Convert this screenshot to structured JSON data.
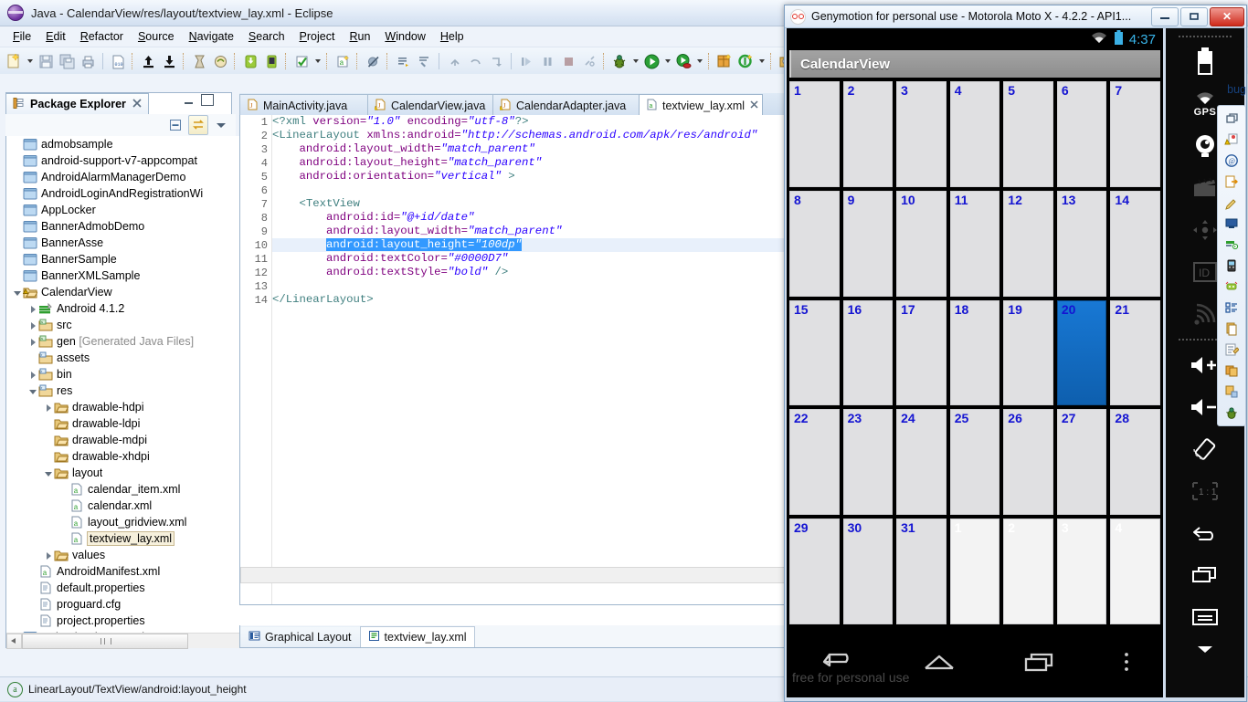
{
  "eclipse": {
    "title": "Java - CalendarView/res/layout/textview_lay.xml - Eclipse",
    "menu": [
      "File",
      "Edit",
      "Refactor",
      "Source",
      "Navigate",
      "Search",
      "Project",
      "Run",
      "Window",
      "Help"
    ],
    "perspective_label": "bug",
    "status_text": "LinearLayout/TextView/android:layout_height",
    "toolbar_icons": [
      "new-wizard-icon",
      "new-wizard-dropdown",
      "save-icon",
      "save-all-icon",
      "print-icon",
      "toggle-binary-icon",
      "export-icon",
      "import-icon",
      "android-sdk-manager-icon",
      "android-virtual-device-icon",
      "android-download-icon",
      "android-device-icon",
      "checkmark-icon",
      "checkmark-dropdown",
      "new-android-project-icon",
      "skip-breakpoints-icon",
      "step-return-icon",
      "lint-icon",
      "next-annotation-icon",
      "previous-annotation-icon",
      "last-edit-location-icon",
      "step-into-icon",
      "pause-icon",
      "terminate-icon",
      "disconnect-icon",
      "debug-icon",
      "debug-dropdown",
      "run-icon",
      "run-dropdown",
      "coverage-icon",
      "coverage-dropdown",
      "new-window-icon",
      "new-java-class-icon",
      "new-java-class-dropdown",
      "open-type-icon"
    ],
    "package_explorer": {
      "tab_label": "Package Explorer",
      "tab_icon": "package-explorer-icon",
      "close_icon": "close-icon",
      "minimize_icon": "minimize-icon",
      "maximize_icon": "maximize-icon",
      "collapse_all_icon": "collapse-all-icon",
      "link_with_editor_icon": "link-with-editor-icon",
      "view_menu_icon": "view-menu-icon",
      "tree": [
        {
          "label": "admobsample",
          "indent": 0,
          "icon": "project-closed",
          "arrow": "none"
        },
        {
          "label": "android-support-v7-appcompat",
          "indent": 0,
          "icon": "project-closed",
          "arrow": "none"
        },
        {
          "label": "AndroidAlarmManagerDemo",
          "indent": 0,
          "icon": "project-closed",
          "arrow": "none"
        },
        {
          "label": "AndroidLoginAndRegistrationWi",
          "indent": 0,
          "icon": "project-closed",
          "arrow": "none"
        },
        {
          "label": "AppLocker",
          "indent": 0,
          "icon": "project-closed",
          "arrow": "none"
        },
        {
          "label": "BannerAdmobDemo",
          "indent": 0,
          "icon": "project-closed",
          "arrow": "none"
        },
        {
          "label": "BannerAsse",
          "indent": 0,
          "icon": "project-closed",
          "arrow": "none"
        },
        {
          "label": "BannerSample",
          "indent": 0,
          "icon": "project-closed",
          "arrow": "none"
        },
        {
          "label": "BannerXMLSample",
          "indent": 0,
          "icon": "project-closed",
          "arrow": "none"
        },
        {
          "label": "CalendarView",
          "indent": 0,
          "icon": "project-open-warning",
          "arrow": "open"
        },
        {
          "label": "Android 4.1.2",
          "indent": 1,
          "icon": "library",
          "arrow": "closed"
        },
        {
          "label": "src",
          "indent": 1,
          "icon": "source-folder",
          "arrow": "closed"
        },
        {
          "label": "gen",
          "suffix": " [Generated Java Files]",
          "indent": 1,
          "icon": "source-folder",
          "arrow": "closed"
        },
        {
          "label": "assets",
          "indent": 1,
          "icon": "folder-res",
          "arrow": "none"
        },
        {
          "label": "bin",
          "indent": 1,
          "icon": "folder-res",
          "arrow": "closed"
        },
        {
          "label": "res",
          "indent": 1,
          "icon": "folder-res",
          "arrow": "open"
        },
        {
          "label": "drawable-hdpi",
          "indent": 2,
          "icon": "folder",
          "arrow": "closed"
        },
        {
          "label": "drawable-ldpi",
          "indent": 2,
          "icon": "folder",
          "arrow": "none"
        },
        {
          "label": "drawable-mdpi",
          "indent": 2,
          "icon": "folder",
          "arrow": "none"
        },
        {
          "label": "drawable-xhdpi",
          "indent": 2,
          "icon": "folder",
          "arrow": "none"
        },
        {
          "label": "layout",
          "indent": 2,
          "icon": "folder",
          "arrow": "open"
        },
        {
          "label": "calendar_item.xml",
          "indent": 3,
          "icon": "xml-file",
          "arrow": "none"
        },
        {
          "label": "calendar.xml",
          "indent": 3,
          "icon": "xml-file",
          "arrow": "none"
        },
        {
          "label": "layout_gridview.xml",
          "indent": 3,
          "icon": "xml-file",
          "arrow": "none"
        },
        {
          "label": "textview_lay.xml",
          "indent": 3,
          "icon": "xml-file",
          "arrow": "none",
          "selected": true
        },
        {
          "label": "values",
          "indent": 2,
          "icon": "folder",
          "arrow": "closed"
        },
        {
          "label": "AndroidManifest.xml",
          "indent": 1,
          "icon": "xml-file",
          "arrow": "none"
        },
        {
          "label": "default.properties",
          "indent": 1,
          "icon": "text-file",
          "arrow": "none"
        },
        {
          "label": "proguard.cfg",
          "indent": 1,
          "icon": "text-file",
          "arrow": "none"
        },
        {
          "label": "project.properties",
          "indent": 1,
          "icon": "text-file",
          "arrow": "none"
        },
        {
          "label": "CalendarViewSample",
          "indent": 0,
          "icon": "project-closed",
          "arrow": "none"
        }
      ]
    },
    "editor": {
      "tabs": [
        {
          "label": "MainActivity.java",
          "icon": "java-file-icon",
          "active": false
        },
        {
          "label": "CalendarView.java",
          "icon": "java-file-warning-icon",
          "active": false
        },
        {
          "label": "CalendarAdapter.java",
          "icon": "java-file-warning-icon",
          "active": false
        },
        {
          "label": "textview_lay.xml",
          "icon": "xml-file-icon",
          "active": true
        }
      ],
      "close_icon": "close-icon",
      "bottom_tabs": [
        {
          "label": "Graphical Layout",
          "icon": "graphical-layout-icon",
          "active": false
        },
        {
          "label": "textview_lay.xml",
          "icon": "xml-source-icon",
          "active": true
        }
      ],
      "code_lines": [
        {
          "n": 1,
          "tokens": [
            {
              "t": "<?xml ",
              "c": "pi"
            },
            {
              "t": "version=",
              "c": "attr"
            },
            {
              "t": "\"1.0\"",
              "c": "val"
            },
            {
              "t": " encoding=",
              "c": "attr"
            },
            {
              "t": "\"utf-8\"",
              "c": "val"
            },
            {
              "t": "?>",
              "c": "pi"
            }
          ]
        },
        {
          "n": 2,
          "tokens": [
            {
              "t": "<LinearLayout ",
              "c": "tag"
            },
            {
              "t": "xmlns:android=",
              "c": "attr"
            },
            {
              "t": "\"http://schemas.android.com/apk/res/android\"",
              "c": "val"
            }
          ]
        },
        {
          "n": 3,
          "tokens": [
            {
              "t": "    android:layout_width=",
              "c": "attr"
            },
            {
              "t": "\"match_parent\"",
              "c": "val"
            }
          ]
        },
        {
          "n": 4,
          "tokens": [
            {
              "t": "    android:layout_height=",
              "c": "attr"
            },
            {
              "t": "\"match_parent\"",
              "c": "val"
            }
          ]
        },
        {
          "n": 5,
          "tokens": [
            {
              "t": "    android:orientation=",
              "c": "attr"
            },
            {
              "t": "\"vertical\"",
              "c": "val"
            },
            {
              "t": " >",
              "c": "tag"
            }
          ]
        },
        {
          "n": 6,
          "tokens": []
        },
        {
          "n": 7,
          "tokens": [
            {
              "t": "    <TextView",
              "c": "tag"
            }
          ]
        },
        {
          "n": 8,
          "tokens": [
            {
              "t": "        android:id=",
              "c": "attr"
            },
            {
              "t": "\"@+id/date\"",
              "c": "val"
            }
          ]
        },
        {
          "n": 9,
          "tokens": [
            {
              "t": "        android:layout_width=",
              "c": "attr"
            },
            {
              "t": "\"match_parent\"",
              "c": "val"
            }
          ]
        },
        {
          "n": 10,
          "highlight": true,
          "tokens": [
            {
              "t": "        ",
              "c": "plain"
            },
            {
              "t": "android:layout_height=",
              "c": "attr",
              "sel": true
            },
            {
              "t": "\"100dp\"",
              "c": "val",
              "sel": true
            }
          ]
        },
        {
          "n": 11,
          "tokens": [
            {
              "t": "        android:textColor=",
              "c": "attr"
            },
            {
              "t": "\"#0000D7\"",
              "c": "val"
            }
          ]
        },
        {
          "n": 12,
          "tokens": [
            {
              "t": "        android:textStyle=",
              "c": "attr"
            },
            {
              "t": "\"bold\"",
              "c": "val"
            },
            {
              "t": " />",
              "c": "tag"
            }
          ]
        },
        {
          "n": 13,
          "tokens": []
        },
        {
          "n": 14,
          "tokens": [
            {
              "t": "</LinearLayout>",
              "c": "tag"
            }
          ]
        }
      ]
    }
  },
  "genymotion": {
    "window_title": "Genymotion for personal use - Motorola Moto X - 4.2.2 - API1...",
    "logo_icon": "genymotion-logo-icon",
    "minimize_label": "minimize-icon",
    "restore_label": "restore-icon",
    "close_label": "✕",
    "android": {
      "status_time": "4:37",
      "wifi_icon": "wifi-icon",
      "battery_icon": "battery-icon",
      "app_title": "CalendarView",
      "watermark": "free for personal use",
      "nav": [
        "back-icon",
        "home-icon",
        "recents-icon",
        "overflow-menu-icon"
      ],
      "selected_day": "20",
      "calendar_cells": [
        {
          "d": "1",
          "m": "cur"
        },
        {
          "d": "2",
          "m": "cur"
        },
        {
          "d": "3",
          "m": "cur"
        },
        {
          "d": "4",
          "m": "cur"
        },
        {
          "d": "5",
          "m": "cur"
        },
        {
          "d": "6",
          "m": "cur"
        },
        {
          "d": "7",
          "m": "cur"
        },
        {
          "d": "8",
          "m": "cur"
        },
        {
          "d": "9",
          "m": "cur"
        },
        {
          "d": "10",
          "m": "cur"
        },
        {
          "d": "11",
          "m": "cur"
        },
        {
          "d": "12",
          "m": "cur"
        },
        {
          "d": "13",
          "m": "cur"
        },
        {
          "d": "14",
          "m": "cur"
        },
        {
          "d": "15",
          "m": "cur"
        },
        {
          "d": "16",
          "m": "cur"
        },
        {
          "d": "17",
          "m": "cur"
        },
        {
          "d": "18",
          "m": "cur"
        },
        {
          "d": "19",
          "m": "cur"
        },
        {
          "d": "20",
          "m": "sel"
        },
        {
          "d": "21",
          "m": "cur"
        },
        {
          "d": "22",
          "m": "cur"
        },
        {
          "d": "23",
          "m": "cur"
        },
        {
          "d": "24",
          "m": "cur"
        },
        {
          "d": "25",
          "m": "cur"
        },
        {
          "d": "26",
          "m": "cur"
        },
        {
          "d": "27",
          "m": "cur"
        },
        {
          "d": "28",
          "m": "cur"
        },
        {
          "d": "29",
          "m": "cur"
        },
        {
          "d": "30",
          "m": "cur"
        },
        {
          "d": "31",
          "m": "cur"
        },
        {
          "d": "1",
          "m": "other"
        },
        {
          "d": "2",
          "m": "other"
        },
        {
          "d": "3",
          "m": "other"
        },
        {
          "d": "4",
          "m": "other"
        }
      ]
    },
    "sidebar": [
      {
        "name": "battery-widget-icon",
        "label": ""
      },
      {
        "name": "gps-widget-icon",
        "label": "GPS"
      },
      {
        "name": "camera-widget-icon",
        "label": ""
      },
      {
        "name": "video-recorder-icon",
        "label": "",
        "dim": true
      },
      {
        "name": "accelerometer-icon",
        "label": "",
        "dim": true
      },
      {
        "name": "identifiers-icon",
        "label": "ID",
        "dim": true
      },
      {
        "name": "network-signal-icon",
        "label": "",
        "dim": true
      },
      {
        "name": "volume-up-icon",
        "label": ""
      },
      {
        "name": "volume-down-icon",
        "label": ""
      },
      {
        "name": "rotate-icon",
        "label": ""
      },
      {
        "name": "zoom-one-to-one-icon",
        "label": "1 : 1",
        "dim": true
      },
      {
        "name": "back-icon",
        "label": ""
      },
      {
        "name": "recents-icon",
        "label": ""
      },
      {
        "name": "menu-icon",
        "label": ""
      },
      {
        "name": "expand-more-icon",
        "label": ""
      }
    ]
  }
}
